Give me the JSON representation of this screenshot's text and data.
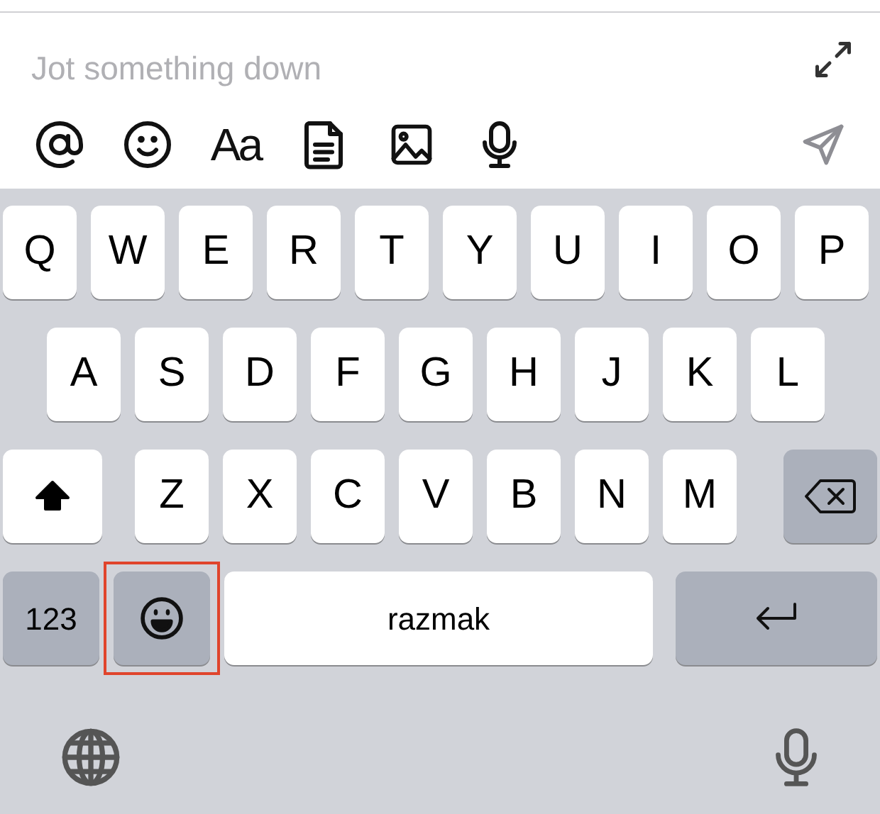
{
  "compose": {
    "placeholder": "Jot something down"
  },
  "toolbar": [
    {
      "kind": "mention"
    },
    {
      "kind": "emoji"
    },
    {
      "kind": "text",
      "label": "Aa"
    },
    {
      "kind": "document"
    },
    {
      "kind": "image"
    },
    {
      "kind": "microphone"
    }
  ],
  "send_button": {
    "disabled": true
  },
  "keyboard": {
    "rows": [
      {
        "keys": [
          {
            "kind": "letter",
            "label": "Q"
          },
          {
            "kind": "letter",
            "label": "W"
          },
          {
            "kind": "letter",
            "label": "E"
          },
          {
            "kind": "letter",
            "label": "R"
          },
          {
            "kind": "letter",
            "label": "T"
          },
          {
            "kind": "letter",
            "label": "Y"
          },
          {
            "kind": "letter",
            "label": "U"
          },
          {
            "kind": "letter",
            "label": "I"
          },
          {
            "kind": "letter",
            "label": "O"
          },
          {
            "kind": "letter",
            "label": "P"
          }
        ]
      },
      {
        "keys": [
          {
            "kind": "letter",
            "label": "A"
          },
          {
            "kind": "letter",
            "label": "S"
          },
          {
            "kind": "letter",
            "label": "D"
          },
          {
            "kind": "letter",
            "label": "F"
          },
          {
            "kind": "letter",
            "label": "G"
          },
          {
            "kind": "letter",
            "label": "H"
          },
          {
            "kind": "letter",
            "label": "J"
          },
          {
            "kind": "letter",
            "label": "K"
          },
          {
            "kind": "letter",
            "label": "L"
          }
        ]
      },
      {
        "keys": [
          {
            "kind": "shift",
            "on": true
          },
          {
            "kind": "letter",
            "label": "Z"
          },
          {
            "kind": "letter",
            "label": "X"
          },
          {
            "kind": "letter",
            "label": "C"
          },
          {
            "kind": "letter",
            "label": "V"
          },
          {
            "kind": "letter",
            "label": "B"
          },
          {
            "kind": "letter",
            "label": "N"
          },
          {
            "kind": "letter",
            "label": "M"
          },
          {
            "kind": "backspace"
          }
        ]
      }
    ],
    "bottom_row": [
      {
        "kind": "numbers",
        "label": "123",
        "highlighted": false
      },
      {
        "kind": "emoji",
        "highlighted": true
      },
      {
        "kind": "space",
        "label": "razmak",
        "highlighted": false
      },
      {
        "kind": "return",
        "highlighted": false
      }
    ],
    "footer": [
      {
        "kind": "globe"
      },
      {
        "kind": "dictation"
      }
    ]
  }
}
